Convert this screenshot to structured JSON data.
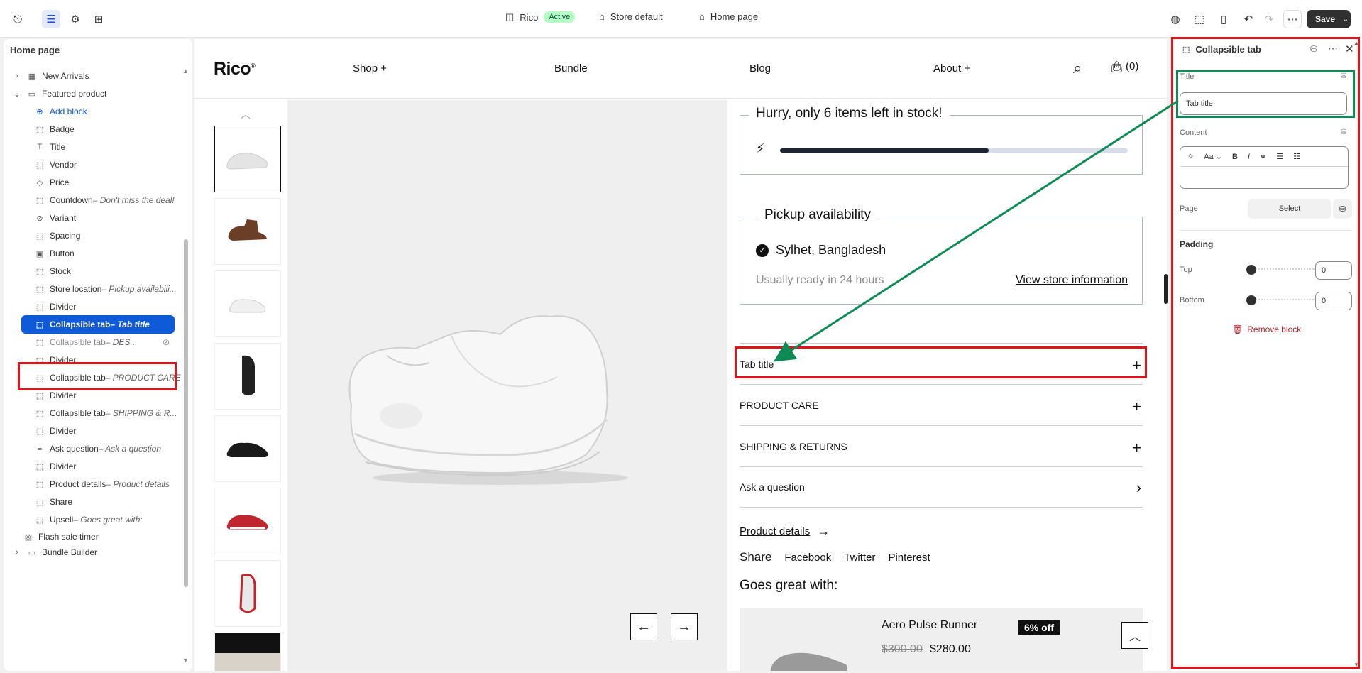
{
  "topbar": {
    "store_name": "Rico",
    "store_status": "Active",
    "theme_label": "Store default",
    "page_label": "Home page",
    "save_label": "Save"
  },
  "left_panel": {
    "title": "Home page",
    "items": [
      {
        "label": "New Arrivals",
        "suffix": ""
      },
      {
        "label": "Featured product",
        "suffix": ""
      },
      {
        "label": "Add block",
        "suffix": ""
      },
      {
        "label": "Badge",
        "suffix": ""
      },
      {
        "label": "Title",
        "suffix": ""
      },
      {
        "label": "Vendor",
        "suffix": ""
      },
      {
        "label": "Price",
        "suffix": ""
      },
      {
        "label": "Countdown",
        "suffix": " – Don't miss the deal!"
      },
      {
        "label": "Variant",
        "suffix": ""
      },
      {
        "label": "Spacing",
        "suffix": ""
      },
      {
        "label": "Button",
        "suffix": ""
      },
      {
        "label": "Stock",
        "suffix": ""
      },
      {
        "label": "Store location",
        "suffix": " – Pickup availabili..."
      },
      {
        "label": "Divider",
        "suffix": ""
      },
      {
        "label": "Collapsible tab",
        "suffix": " – Tab title"
      },
      {
        "label": "Collapsible tab",
        "suffix": " – DES..."
      },
      {
        "label": "Divider",
        "suffix": ""
      },
      {
        "label": "Collapsible tab",
        "suffix": " – PRODUCT CARE"
      },
      {
        "label": "Divider",
        "suffix": ""
      },
      {
        "label": "Collapsible tab",
        "suffix": " – SHIPPING & R..."
      },
      {
        "label": "Divider",
        "suffix": ""
      },
      {
        "label": "Ask question",
        "suffix": " – Ask a question"
      },
      {
        "label": "Divider",
        "suffix": ""
      },
      {
        "label": "Product details",
        "suffix": " – Product details"
      },
      {
        "label": "Share",
        "suffix": ""
      },
      {
        "label": "Upsell",
        "suffix": " – Goes great with:"
      },
      {
        "label": "Flash sale timer",
        "suffix": ""
      },
      {
        "label": "Bundle Builder",
        "suffix": ""
      }
    ]
  },
  "store": {
    "logo": "Rico",
    "nav": [
      "Shop +",
      "Bundle",
      "Blog",
      "About +"
    ],
    "cart_count": "(0)",
    "stock_message": "Hurry, only 6 items left in stock!",
    "stock_fill": 0.6,
    "pickup_title": "Pickup availability",
    "pickup_location": "Sylhet, Bangladesh",
    "pickup_ready": "Usually ready in 24 hours",
    "pickup_link": "View store information",
    "tabs": [
      "Tab title",
      "PRODUCT CARE",
      "SHIPPING & RETURNS",
      "Ask a question"
    ],
    "product_details_link": "Product details",
    "share_label": "Share",
    "share_links": [
      "Facebook",
      "Twitter",
      "Pinterest"
    ],
    "upsell_title": "Goes great with:",
    "upsell_name": "Aero Pulse Runner",
    "upsell_old_price": "$300.00",
    "upsell_price": "$280.00",
    "upsell_badge": "6% off"
  },
  "right_panel": {
    "title": "Collapsible tab",
    "title_label": "Title",
    "title_value": "Tab title",
    "content_label": "Content",
    "page_label": "Page",
    "page_select": "Select",
    "padding_label": "Padding",
    "top_label": "Top",
    "top_value": "0",
    "bottom_label": "Bottom",
    "bottom_value": "0",
    "remove_label": "Remove block"
  },
  "colors": {
    "accent_blue": "#0f5ad8",
    "annotation_red": "#e1141c",
    "annotation_green": "#0e8a55",
    "active_badge": "#b4fec6"
  }
}
